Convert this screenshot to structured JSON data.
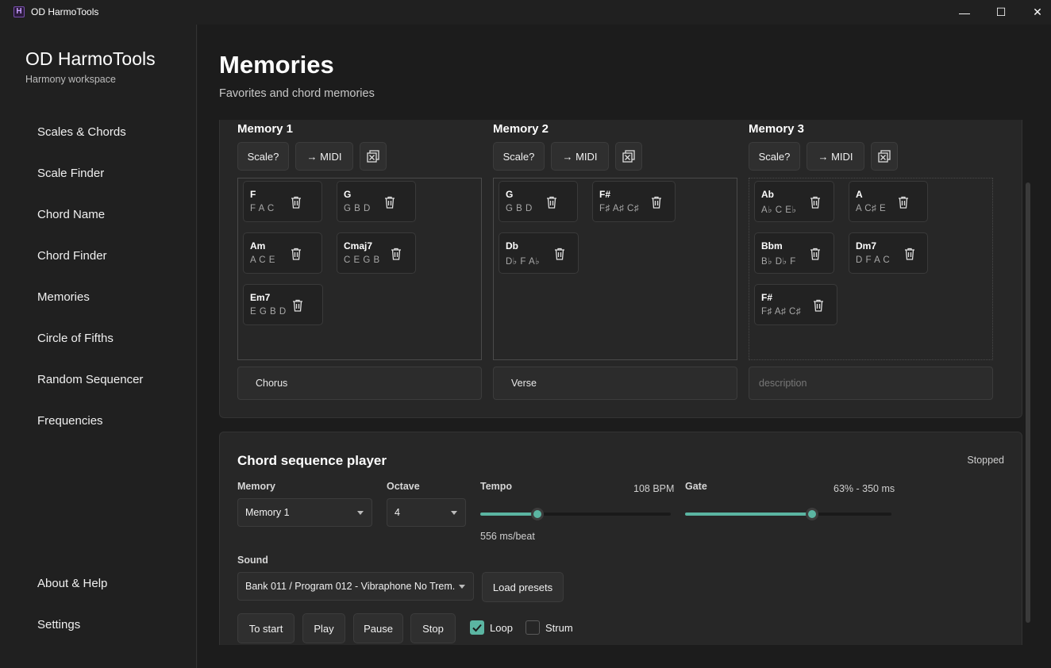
{
  "window": {
    "title": "OD HarmoTools",
    "icon_letter": "H",
    "min_glyph": "—",
    "max_glyph": "☐",
    "close_glyph": "✕"
  },
  "sidebar": {
    "app_name": "OD HarmoTools",
    "app_subtitle": "Harmony workspace",
    "items": [
      {
        "label": "Scales & Chords"
      },
      {
        "label": "Scale Finder"
      },
      {
        "label": "Chord Name"
      },
      {
        "label": "Chord Finder"
      },
      {
        "label": "Memories"
      },
      {
        "label": "Circle of Fifths"
      },
      {
        "label": "Random Sequencer"
      },
      {
        "label": "Frequencies"
      }
    ],
    "footer_items": [
      {
        "label": "About & Help"
      },
      {
        "label": "Settings"
      }
    ]
  },
  "page": {
    "title": "Memories",
    "subtitle": "Favorites and chord memories"
  },
  "memories": [
    {
      "title": "Memory 1",
      "scale_label": "Scale?",
      "midi_label": "→ MIDI",
      "description": "Chorus",
      "description_placeholder": "description",
      "chords": [
        {
          "name": "F",
          "notes": "F A C"
        },
        {
          "name": "G",
          "notes": "G B D"
        },
        {
          "name": "Am",
          "notes": "A C E"
        },
        {
          "name": "Cmaj7",
          "notes": "C E G B"
        },
        {
          "name": "Em7",
          "notes": "E G B D"
        }
      ]
    },
    {
      "title": "Memory 2",
      "scale_label": "Scale?",
      "midi_label": "→ MIDI",
      "description": "Verse",
      "description_placeholder": "description",
      "chords": [
        {
          "name": "G",
          "notes": "G B D"
        },
        {
          "name": "F#",
          "notes": "F♯ A♯ C♯"
        },
        {
          "name": "Db",
          "notes": "D♭ F A♭"
        }
      ]
    },
    {
      "title": "Memory 3",
      "scale_label": "Scale?",
      "midi_label": "→ MIDI",
      "description": "",
      "description_placeholder": "description",
      "chords": [
        {
          "name": "Ab",
          "notes": "A♭ C E♭"
        },
        {
          "name": "A",
          "notes": "A C♯ E"
        },
        {
          "name": "Bbm",
          "notes": "B♭ D♭ F"
        },
        {
          "name": "Dm7",
          "notes": "D F A C"
        },
        {
          "name": "F#",
          "notes": "F♯ A♯ C♯"
        }
      ]
    }
  ],
  "player": {
    "title": "Chord sequence player",
    "status": "Stopped",
    "memory_label": "Memory",
    "memory_value": "Memory 1",
    "octave_label": "Octave",
    "octave_value": "4",
    "tempo_label": "Tempo",
    "tempo_value": "108 BPM",
    "tempo_fraction": 0.3,
    "tempo_sub": "556 ms/beat",
    "gate_label": "Gate",
    "gate_value": "63% - 350 ms",
    "gate_fraction": 0.615,
    "sound_label": "Sound",
    "sound_value": "Bank 011 / Program 012 - Vibraphone No Trem.",
    "load_presets_label": "Load presets",
    "to_start_label": "To start",
    "play_label": "Play",
    "pause_label": "Pause",
    "stop_label": "Stop",
    "loop_label": "Loop",
    "loop_checked": true,
    "strum_label": "Strum",
    "strum_checked": false
  },
  "colors": {
    "accent": "#5bb5a2",
    "background": "#1c1c1c",
    "card": "#272727"
  }
}
